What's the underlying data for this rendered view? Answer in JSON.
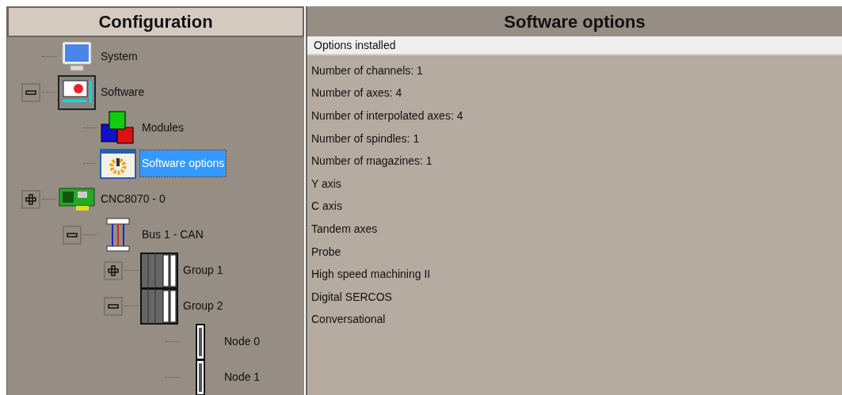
{
  "configuration": {
    "title": "Configuration",
    "tree": [
      {
        "label": "System",
        "kind": "monitor",
        "selected": false
      },
      {
        "label": "Software",
        "kind": "terminal",
        "selected": false,
        "expanded": true,
        "children": [
          {
            "label": "Modules",
            "kind": "cubes",
            "selected": false
          },
          {
            "label": "Software options",
            "kind": "window-gear",
            "selected": true
          }
        ]
      },
      {
        "label": "CNC8070 - 0",
        "kind": "board",
        "selected": false,
        "expanded": false,
        "children": [
          {
            "label": "Bus 1 - CAN",
            "kind": "cable",
            "selected": false,
            "expanded": true,
            "children": [
              {
                "label": "Group 1",
                "kind": "rack",
                "selected": false,
                "expanded": false
              },
              {
                "label": "Group 2",
                "kind": "rack",
                "selected": false,
                "expanded": true,
                "children": [
                  {
                    "label": "Node 0",
                    "kind": "node",
                    "selected": false
                  },
                  {
                    "label": "Node 1",
                    "kind": "node",
                    "selected": false
                  }
                ]
              }
            ]
          }
        ]
      }
    ]
  },
  "software_options": {
    "title": "Software options",
    "header": "Options installed",
    "items": [
      "Number of channels: 1",
      "Number of axes: 4",
      "Number of interpolated axes: 4",
      "Number of spindles: 1",
      "Number of magazines: 1",
      "Y axis",
      "C axis",
      "Tandem axes",
      "Probe",
      "High speed machining II",
      "Digital SERCOS",
      "Conversational"
    ]
  }
}
